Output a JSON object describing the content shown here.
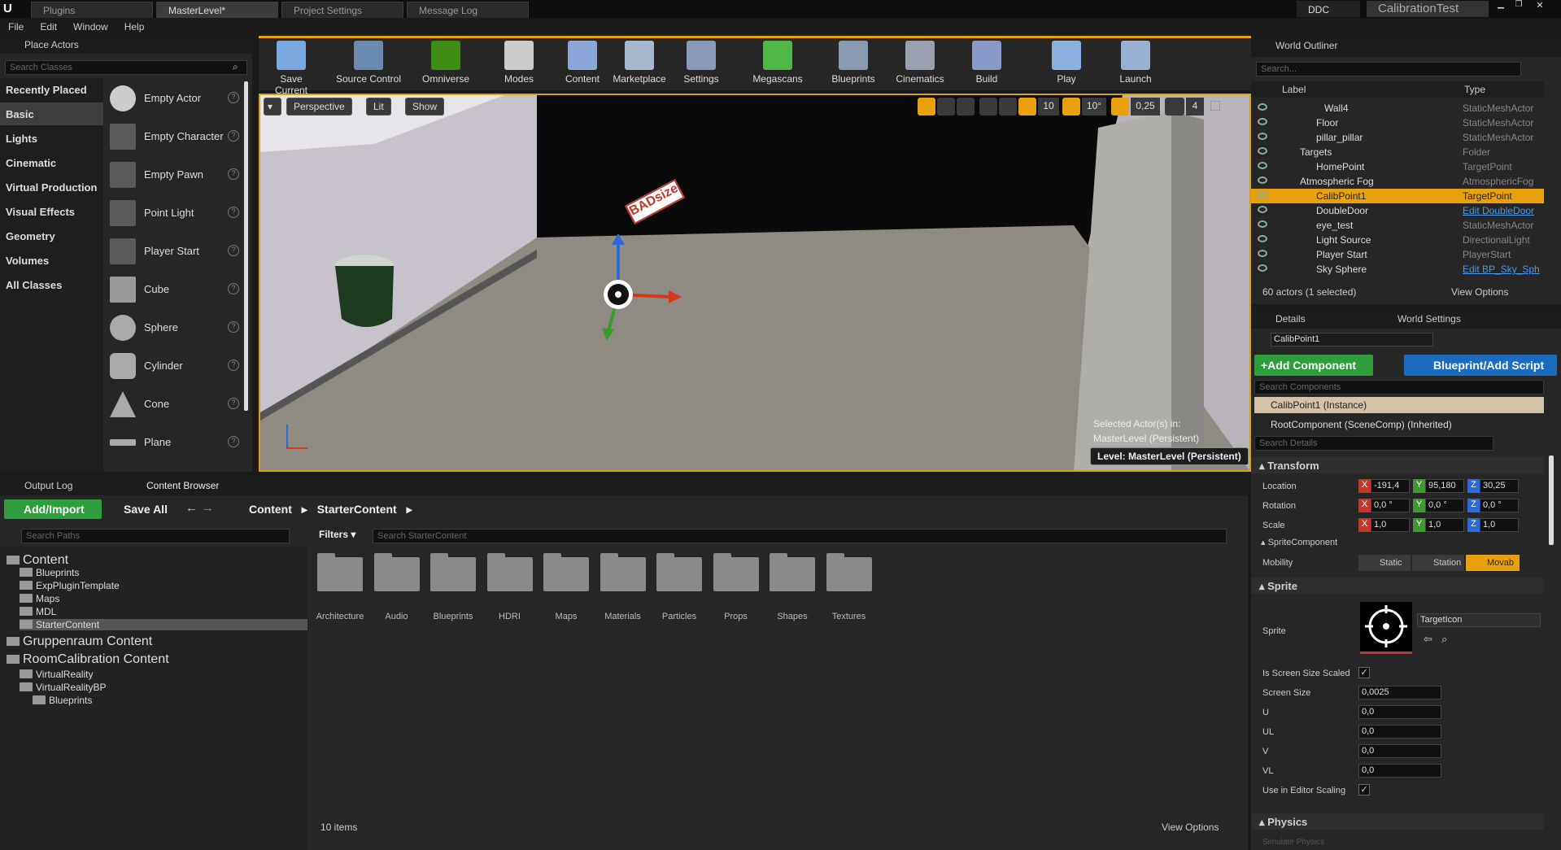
{
  "tabs": {
    "plugins": "Plugins",
    "level": "MasterLevel*",
    "project_settings": "Project Settings",
    "message_log": "Message Log",
    "ddc": "DDC",
    "project": "CalibrationTest"
  },
  "menu": [
    "File",
    "Edit",
    "Window",
    "Help"
  ],
  "place_actors": {
    "title": "Place Actors",
    "search_placeholder": "Search Classes",
    "categories": [
      "Recently Placed",
      "Basic",
      "Lights",
      "Cinematic",
      "Virtual Production",
      "Visual Effects",
      "Geometry",
      "Volumes",
      "All Classes"
    ],
    "items": [
      "Empty Actor",
      "Empty Character",
      "Empty Pawn",
      "Point Light",
      "Player Start",
      "Cube",
      "Sphere",
      "Cylinder",
      "Cone",
      "Plane"
    ]
  },
  "toolbar": [
    "Save Current",
    "Source Control",
    "Omniverse",
    "Modes",
    "Content",
    "Marketplace",
    "Settings",
    "Megascans",
    "Blueprints",
    "Cinematics",
    "Build",
    "Play",
    "Launch"
  ],
  "viewport": {
    "perspective": "Perspective",
    "lit": "Lit",
    "show": "Show",
    "grid_snap": "10",
    "rot_snap": "10°",
    "scale_snap": "0,25",
    "cam_speed": "4",
    "selected_line1": "Selected Actor(s) in:",
    "selected_line2": "MasterLevel (Persistent)",
    "level": "Level:  MasterLevel (Persistent)",
    "sign": "BADsize"
  },
  "outliner": {
    "title": "World Outliner",
    "search_placeholder": "Search...",
    "col_label": "Label",
    "col_type": "Type",
    "rows": [
      {
        "name": "Wall4",
        "type": "StaticMeshActor"
      },
      {
        "name": "Floor",
        "type": "StaticMeshActor"
      },
      {
        "name": "pillar_pillar",
        "type": "StaticMeshActor"
      },
      {
        "name": "Targets",
        "type": "Folder"
      },
      {
        "name": "HomePoint",
        "type": "TargetPoint"
      },
      {
        "name": "Atmospheric Fog",
        "type": "AtmosphericFog"
      },
      {
        "name": "CalibPoint1",
        "type": "TargetPoint"
      },
      {
        "name": "DoubleDoor",
        "type": "Edit DoubleDoor"
      },
      {
        "name": "eye_test",
        "type": "StaticMeshActor"
      },
      {
        "name": "Light Source",
        "type": "DirectionalLight"
      },
      {
        "name": "Player Start",
        "type": "PlayerStart"
      },
      {
        "name": "Sky Sphere",
        "type": "Edit BP_Sky_Sph"
      }
    ],
    "status": "60 actors (1 selected)",
    "view_options": "View Options"
  },
  "details": {
    "tab1": "Details",
    "tab2": "World Settings",
    "name": "CalibPoint1",
    "add_component": "+Add Component",
    "blueprint": "Blueprint/Add Script",
    "search_components": "Search Components",
    "instance": "CalibPoint1 (Instance)",
    "root": "RootComponent (SceneComp) (Inherited)",
    "search_details": "Search Details",
    "transform": "Transform",
    "location": "Location",
    "rotation": "Rotation",
    "scale": "Scale",
    "loc": [
      "-191,4",
      "95,180",
      "30,25"
    ],
    "rot": [
      "0,0 °",
      "0,0 °",
      "0,0 °"
    ],
    "scl": [
      "1,0",
      "1,0",
      "1,0"
    ],
    "sprite_component": "SpriteComponent",
    "mobility": "Mobility",
    "mob_static": "Static",
    "mob_station": "Station",
    "mob_movable": "Movab",
    "sprite_section": "Sprite",
    "sprite": "Sprite",
    "sprite_asset": "TargetIcon",
    "is_screen_size_scaled": "Is Screen Size Scaled",
    "screen_size": "Screen Size",
    "screen_size_val": "0,0025",
    "u": "U",
    "ul": "UL",
    "v": "V",
    "vl": "VL",
    "u_val": "0,0",
    "ul_val": "0,0",
    "v_val": "0,0",
    "vl_val": "0,0",
    "use_editor_scaling": "Use in Editor Scaling",
    "physics": "Physics",
    "simulate": "Simulate Physics"
  },
  "bottom": {
    "output_log": "Output Log",
    "content_browser": "Content Browser",
    "add_import": "Add/Import",
    "save_all": "Save All",
    "crumb1": "Content",
    "crumb2": "StarterContent",
    "search_paths": "Search Paths",
    "filters": "Filters",
    "search_content": "Search StarterContent",
    "items_count": "10 items",
    "view_options": "View Options",
    "folders": [
      "Architecture",
      "Audio",
      "Blueprints",
      "HDRI",
      "Maps",
      "Materials",
      "Particles",
      "Props",
      "Shapes",
      "Textures"
    ],
    "tree": [
      {
        "t": "Content",
        "i": 0,
        "big": true
      },
      {
        "t": "Blueprints",
        "i": 1
      },
      {
        "t": "ExpPluginTemplate",
        "i": 1
      },
      {
        "t": "Maps",
        "i": 1
      },
      {
        "t": "MDL",
        "i": 1
      },
      {
        "t": "StarterContent",
        "i": 1,
        "sel": true
      },
      {
        "t": "Gruppenraum Content",
        "i": 0,
        "big": true
      },
      {
        "t": "RoomCalibration Content",
        "i": 0,
        "big": true
      },
      {
        "t": "VirtualReality",
        "i": 1
      },
      {
        "t": "VirtualRealityBP",
        "i": 1
      },
      {
        "t": "Blueprints",
        "i": 2
      }
    ]
  },
  "colors": {
    "accent": "#e8a00c",
    "green": "#2e9e3c",
    "blue": "#1b6bbf"
  }
}
